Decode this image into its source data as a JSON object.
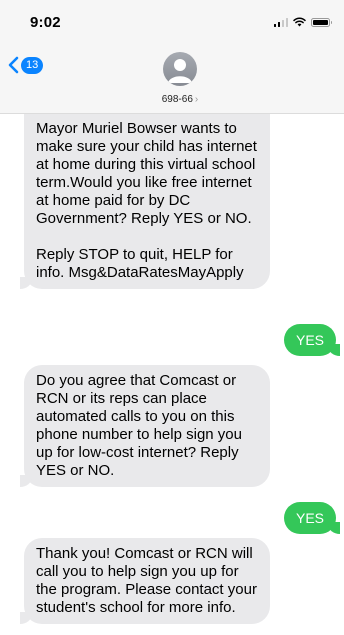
{
  "status_bar": {
    "time": "9:02"
  },
  "header": {
    "back_badge": "13",
    "contact_name": "698-66",
    "chevron": "›"
  },
  "messages": [
    {
      "direction": "incoming",
      "paragraphs": [
        "Mayor Muriel Bowser wants to make sure your child has internet at home during this virtual school term.Would you like free internet at home paid for by DC Government? Reply YES or NO.",
        "Reply STOP to quit, HELP for info. Msg&DataRatesMayApply"
      ]
    },
    {
      "direction": "outgoing",
      "text": "YES"
    },
    {
      "direction": "incoming",
      "paragraphs": [
        "Do you agree that Comcast or RCN or its reps can place automated calls to you on this phone number to help sign you up for low-cost internet? Reply YES or NO."
      ]
    },
    {
      "direction": "outgoing",
      "text": "YES"
    },
    {
      "direction": "incoming",
      "paragraphs": [
        "Thank you! Comcast or RCN will call you to help sign you up for the program. Please contact your student's school for more info."
      ]
    }
  ],
  "colors": {
    "incoming_bubble": "#e9e9eb",
    "outgoing_bubble": "#34c759",
    "accent": "#0a84ff"
  },
  "icons": [
    "signal-icon",
    "wifi-icon",
    "battery-icon",
    "back-chevron-icon",
    "contact-avatar-icon"
  ]
}
